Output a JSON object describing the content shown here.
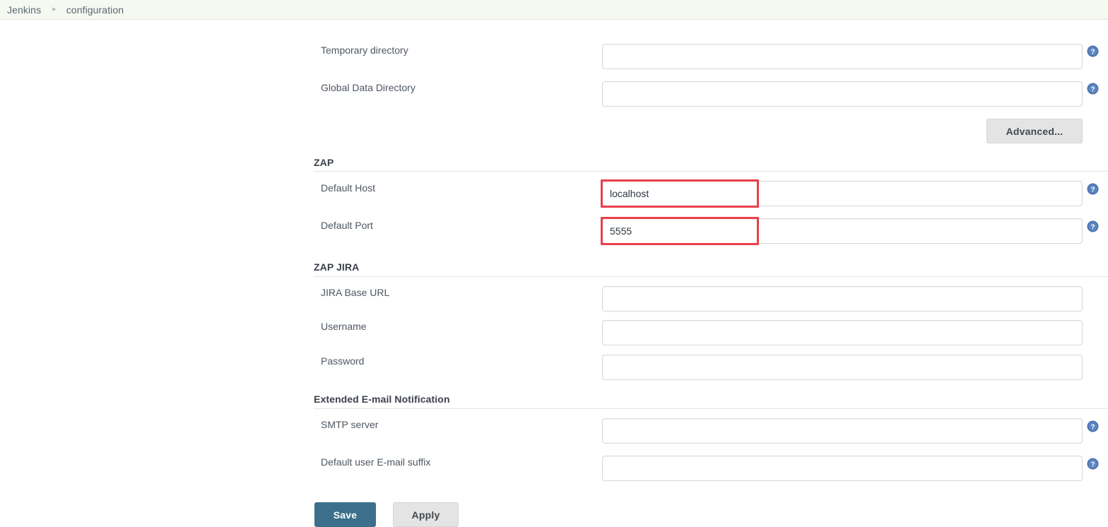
{
  "breadcrumb": {
    "items": [
      {
        "label": "Jenkins"
      },
      {
        "label": "configuration"
      }
    ],
    "separator": "▸"
  },
  "sections": [
    {
      "id": "top-fields",
      "title": "",
      "fields": [
        {
          "label": "Temporary directory",
          "value": "",
          "placeholder": "",
          "has_help": true
        },
        {
          "label": "Global Data Directory",
          "value": "",
          "placeholder": "",
          "has_help": true
        }
      ]
    },
    {
      "id": "zap",
      "title": "ZAP",
      "fields": [
        {
          "label": "Default Host",
          "value": "localhost",
          "placeholder": "",
          "has_help": true,
          "highlighted": true
        },
        {
          "label": "Default Port",
          "value": "5555",
          "placeholder": "",
          "has_help": true,
          "highlighted": true
        }
      ]
    },
    {
      "id": "zap-jira",
      "title": "ZAP JIRA",
      "fields": [
        {
          "label": "JIRA Base URL",
          "value": "",
          "placeholder": "",
          "has_help": false
        },
        {
          "label": "Username",
          "value": "",
          "placeholder": "",
          "has_help": false
        },
        {
          "label": "Password",
          "value": "",
          "placeholder": "",
          "has_help": false
        }
      ]
    },
    {
      "id": "extended-email",
      "title": "Extended E-mail Notification",
      "fields": [
        {
          "label": "SMTP server",
          "value": "",
          "placeholder": "",
          "has_help": true
        },
        {
          "label": "Default user E-mail suffix",
          "value": "",
          "placeholder": "",
          "has_help": true
        }
      ]
    }
  ],
  "buttons": {
    "advanced": "Advanced...",
    "save": "Save",
    "apply": "Apply"
  },
  "icons": {
    "help": "help-icon"
  },
  "colors": {
    "accent": "#3b6f8b",
    "annotation": "#ea3f49",
    "breadcrumb_bg": "#f5f9f2",
    "field_border": "#d8d8d8",
    "label_text": "#4e5762"
  }
}
